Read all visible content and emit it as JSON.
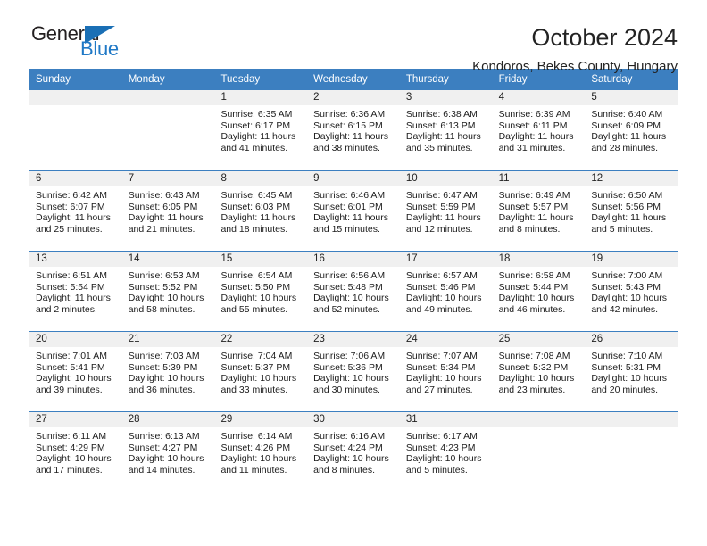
{
  "brand": {
    "name_part1": "General",
    "name_part2": "Blue",
    "accent_color": "#2079c6"
  },
  "header": {
    "title": "October 2024",
    "subtitle": "Kondoros, Bekes County, Hungary"
  },
  "calendar": {
    "header_bg": "#3c7fc0",
    "daynum_bg": "#f0f0f0",
    "weekday_headers": [
      "Sunday",
      "Monday",
      "Tuesday",
      "Wednesday",
      "Thursday",
      "Friday",
      "Saturday"
    ],
    "weeks": [
      [
        {
          "day": "",
          "empty": true
        },
        {
          "day": "",
          "empty": true
        },
        {
          "day": "1",
          "sunrise": "Sunrise: 6:35 AM",
          "sunset": "Sunset: 6:17 PM",
          "daylight": "Daylight: 11 hours and 41 minutes."
        },
        {
          "day": "2",
          "sunrise": "Sunrise: 6:36 AM",
          "sunset": "Sunset: 6:15 PM",
          "daylight": "Daylight: 11 hours and 38 minutes."
        },
        {
          "day": "3",
          "sunrise": "Sunrise: 6:38 AM",
          "sunset": "Sunset: 6:13 PM",
          "daylight": "Daylight: 11 hours and 35 minutes."
        },
        {
          "day": "4",
          "sunrise": "Sunrise: 6:39 AM",
          "sunset": "Sunset: 6:11 PM",
          "daylight": "Daylight: 11 hours and 31 minutes."
        },
        {
          "day": "5",
          "sunrise": "Sunrise: 6:40 AM",
          "sunset": "Sunset: 6:09 PM",
          "daylight": "Daylight: 11 hours and 28 minutes."
        }
      ],
      [
        {
          "day": "6",
          "sunrise": "Sunrise: 6:42 AM",
          "sunset": "Sunset: 6:07 PM",
          "daylight": "Daylight: 11 hours and 25 minutes."
        },
        {
          "day": "7",
          "sunrise": "Sunrise: 6:43 AM",
          "sunset": "Sunset: 6:05 PM",
          "daylight": "Daylight: 11 hours and 21 minutes."
        },
        {
          "day": "8",
          "sunrise": "Sunrise: 6:45 AM",
          "sunset": "Sunset: 6:03 PM",
          "daylight": "Daylight: 11 hours and 18 minutes."
        },
        {
          "day": "9",
          "sunrise": "Sunrise: 6:46 AM",
          "sunset": "Sunset: 6:01 PM",
          "daylight": "Daylight: 11 hours and 15 minutes."
        },
        {
          "day": "10",
          "sunrise": "Sunrise: 6:47 AM",
          "sunset": "Sunset: 5:59 PM",
          "daylight": "Daylight: 11 hours and 12 minutes."
        },
        {
          "day": "11",
          "sunrise": "Sunrise: 6:49 AM",
          "sunset": "Sunset: 5:57 PM",
          "daylight": "Daylight: 11 hours and 8 minutes."
        },
        {
          "day": "12",
          "sunrise": "Sunrise: 6:50 AM",
          "sunset": "Sunset: 5:56 PM",
          "daylight": "Daylight: 11 hours and 5 minutes."
        }
      ],
      [
        {
          "day": "13",
          "sunrise": "Sunrise: 6:51 AM",
          "sunset": "Sunset: 5:54 PM",
          "daylight": "Daylight: 11 hours and 2 minutes."
        },
        {
          "day": "14",
          "sunrise": "Sunrise: 6:53 AM",
          "sunset": "Sunset: 5:52 PM",
          "daylight": "Daylight: 10 hours and 58 minutes."
        },
        {
          "day": "15",
          "sunrise": "Sunrise: 6:54 AM",
          "sunset": "Sunset: 5:50 PM",
          "daylight": "Daylight: 10 hours and 55 minutes."
        },
        {
          "day": "16",
          "sunrise": "Sunrise: 6:56 AM",
          "sunset": "Sunset: 5:48 PM",
          "daylight": "Daylight: 10 hours and 52 minutes."
        },
        {
          "day": "17",
          "sunrise": "Sunrise: 6:57 AM",
          "sunset": "Sunset: 5:46 PM",
          "daylight": "Daylight: 10 hours and 49 minutes."
        },
        {
          "day": "18",
          "sunrise": "Sunrise: 6:58 AM",
          "sunset": "Sunset: 5:44 PM",
          "daylight": "Daylight: 10 hours and 46 minutes."
        },
        {
          "day": "19",
          "sunrise": "Sunrise: 7:00 AM",
          "sunset": "Sunset: 5:43 PM",
          "daylight": "Daylight: 10 hours and 42 minutes."
        }
      ],
      [
        {
          "day": "20",
          "sunrise": "Sunrise: 7:01 AM",
          "sunset": "Sunset: 5:41 PM",
          "daylight": "Daylight: 10 hours and 39 minutes."
        },
        {
          "day": "21",
          "sunrise": "Sunrise: 7:03 AM",
          "sunset": "Sunset: 5:39 PM",
          "daylight": "Daylight: 10 hours and 36 minutes."
        },
        {
          "day": "22",
          "sunrise": "Sunrise: 7:04 AM",
          "sunset": "Sunset: 5:37 PM",
          "daylight": "Daylight: 10 hours and 33 minutes."
        },
        {
          "day": "23",
          "sunrise": "Sunrise: 7:06 AM",
          "sunset": "Sunset: 5:36 PM",
          "daylight": "Daylight: 10 hours and 30 minutes."
        },
        {
          "day": "24",
          "sunrise": "Sunrise: 7:07 AM",
          "sunset": "Sunset: 5:34 PM",
          "daylight": "Daylight: 10 hours and 27 minutes."
        },
        {
          "day": "25",
          "sunrise": "Sunrise: 7:08 AM",
          "sunset": "Sunset: 5:32 PM",
          "daylight": "Daylight: 10 hours and 23 minutes."
        },
        {
          "day": "26",
          "sunrise": "Sunrise: 7:10 AM",
          "sunset": "Sunset: 5:31 PM",
          "daylight": "Daylight: 10 hours and 20 minutes."
        }
      ],
      [
        {
          "day": "27",
          "sunrise": "Sunrise: 6:11 AM",
          "sunset": "Sunset: 4:29 PM",
          "daylight": "Daylight: 10 hours and 17 minutes."
        },
        {
          "day": "28",
          "sunrise": "Sunrise: 6:13 AM",
          "sunset": "Sunset: 4:27 PM",
          "daylight": "Daylight: 10 hours and 14 minutes."
        },
        {
          "day": "29",
          "sunrise": "Sunrise: 6:14 AM",
          "sunset": "Sunset: 4:26 PM",
          "daylight": "Daylight: 10 hours and 11 minutes."
        },
        {
          "day": "30",
          "sunrise": "Sunrise: 6:16 AM",
          "sunset": "Sunset: 4:24 PM",
          "daylight": "Daylight: 10 hours and 8 minutes."
        },
        {
          "day": "31",
          "sunrise": "Sunrise: 6:17 AM",
          "sunset": "Sunset: 4:23 PM",
          "daylight": "Daylight: 10 hours and 5 minutes."
        },
        {
          "day": "",
          "empty": true
        },
        {
          "day": "",
          "empty": true
        }
      ]
    ]
  }
}
